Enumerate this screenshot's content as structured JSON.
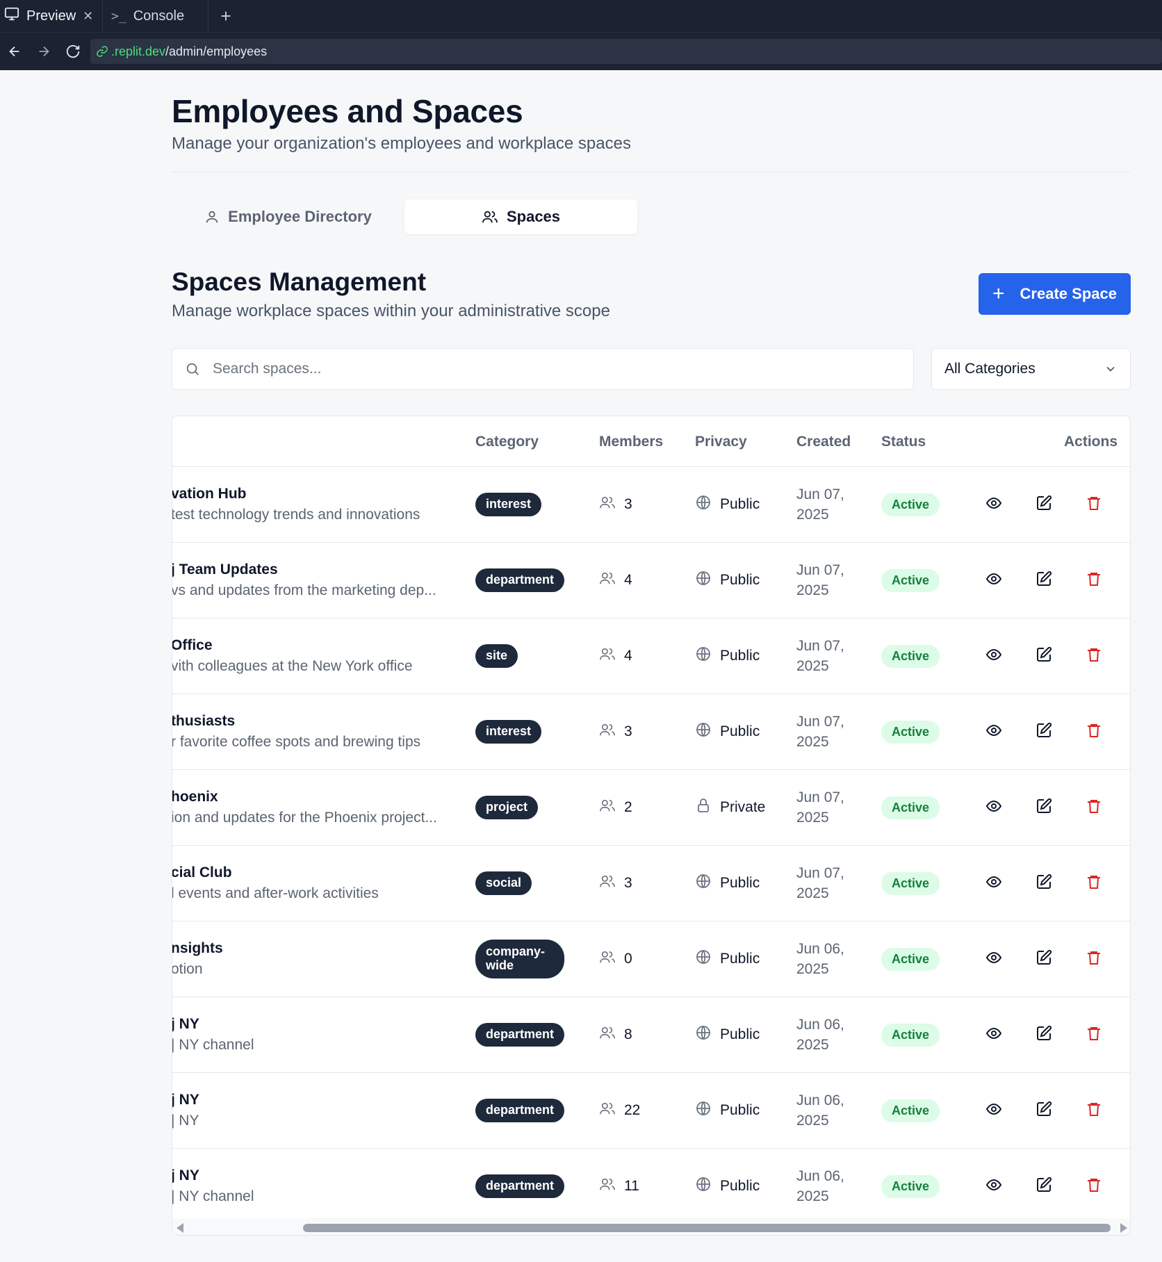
{
  "browser": {
    "tabs": [
      {
        "label": "Preview",
        "icon": "monitor-icon"
      },
      {
        "label": "Console",
        "icon": "terminal-icon"
      }
    ],
    "url_host": ".replit.dev",
    "url_path": "/admin/employees"
  },
  "header": {
    "title": "Employees and Spaces",
    "subtitle": "Manage your organization's employees and workplace spaces"
  },
  "tabs": [
    {
      "label": "Employee Directory",
      "icon": "user-icon",
      "selected": false
    },
    {
      "label": "Spaces",
      "icon": "users-icon",
      "selected": true
    }
  ],
  "section": {
    "title": "Spaces Management",
    "subtitle": "Manage workplace spaces within your administrative scope",
    "create_label": "Create Space"
  },
  "filters": {
    "search_placeholder": "Search spaces...",
    "category_selected": "All Categories"
  },
  "table": {
    "columns": {
      "category": "Category",
      "members": "Members",
      "privacy": "Privacy",
      "created": "Created",
      "status": "Status",
      "actions": "Actions"
    },
    "rows": [
      {
        "name": "vation Hub",
        "desc": "test technology trends and innovations",
        "category": "interest",
        "members": "3",
        "privacy": "Public",
        "created_date": "Jun 07,",
        "created_year": "2025",
        "status": "Active"
      },
      {
        "name": "j Team Updates",
        "desc": "vs and updates from the marketing dep...",
        "category": "department",
        "members": "4",
        "privacy": "Public",
        "created_date": "Jun 07,",
        "created_year": "2025",
        "status": "Active"
      },
      {
        "name": " Office",
        "desc": "vith colleagues at the New York office",
        "category": "site",
        "members": "4",
        "privacy": "Public",
        "created_date": "Jun 07,",
        "created_year": "2025",
        "status": "Active"
      },
      {
        "name": "thusiasts",
        "desc": "r favorite coffee spots and brewing tips",
        "category": "interest",
        "members": "3",
        "privacy": "Public",
        "created_date": "Jun 07,",
        "created_year": "2025",
        "status": "Active"
      },
      {
        "name": "hoenix",
        "desc": "ion and updates for the Phoenix project...",
        "category": "project",
        "members": "2",
        "privacy": "Private",
        "created_date": "Jun 07,",
        "created_year": "2025",
        "status": "Active"
      },
      {
        "name": "cial Club",
        "desc": "l events and after-work activities",
        "category": "social",
        "members": "3",
        "privacy": "Public",
        "created_date": "Jun 07,",
        "created_year": "2025",
        "status": "Active"
      },
      {
        "name": "nsights",
        "desc": "otion",
        "category": "company-wide",
        "members": "0",
        "privacy": "Public",
        "created_date": "Jun 06,",
        "created_year": "2025",
        "status": "Active"
      },
      {
        "name": "j NY",
        "desc": "| NY channel",
        "category": "department",
        "members": "8",
        "privacy": "Public",
        "created_date": "Jun 06,",
        "created_year": "2025",
        "status": "Active"
      },
      {
        "name": "j NY",
        "desc": "| NY",
        "category": "department",
        "members": "22",
        "privacy": "Public",
        "created_date": "Jun 06,",
        "created_year": "2025",
        "status": "Active"
      },
      {
        "name": "j NY",
        "desc": "| NY channel",
        "category": "department",
        "members": "11",
        "privacy": "Public",
        "created_date": "Jun 06,",
        "created_year": "2025",
        "status": "Active"
      }
    ]
  },
  "colors": {
    "accent": "#2563eb",
    "badge_bg": "#1e293b",
    "status_bg": "#dcfce7",
    "status_text": "#15803d",
    "delete": "#dc2626"
  }
}
